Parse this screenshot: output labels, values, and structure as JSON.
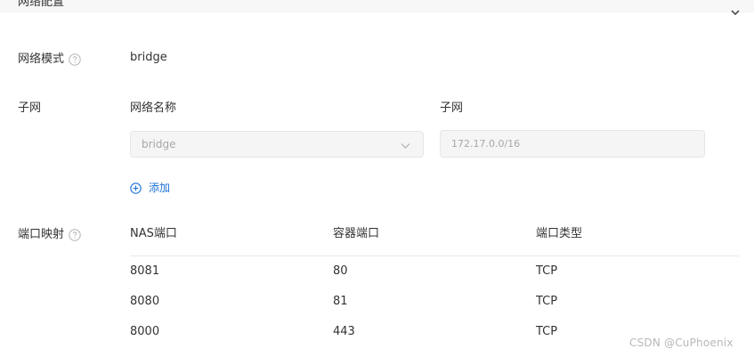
{
  "section": {
    "title": "网络配置",
    "collapse_icon": "chevron-up-icon"
  },
  "network_mode": {
    "label": "网络模式",
    "help_icon": "question-circle-icon",
    "value": "bridge"
  },
  "subnet": {
    "label": "子网",
    "network_name_header": "网络名称",
    "subnet_header": "子网",
    "network_select_value": "bridge",
    "subnet_input_value": "172.17.0.0/16",
    "add_label": "添加",
    "add_icon": "plus-circle-icon"
  },
  "port_mapping": {
    "label": "端口映射",
    "help_icon": "question-circle-icon",
    "columns": [
      "NAS端口",
      "容器端口",
      "端口类型"
    ],
    "rows": [
      [
        "8081",
        "80",
        "TCP"
      ],
      [
        "8080",
        "81",
        "TCP"
      ],
      [
        "8000",
        "443",
        "TCP"
      ]
    ]
  },
  "watermark": "CSDN @CuPhoenix",
  "colors": {
    "link": "#1a6fd6",
    "disabled_bg": "#f5f5f5",
    "disabled_text": "#a8a8a8"
  }
}
